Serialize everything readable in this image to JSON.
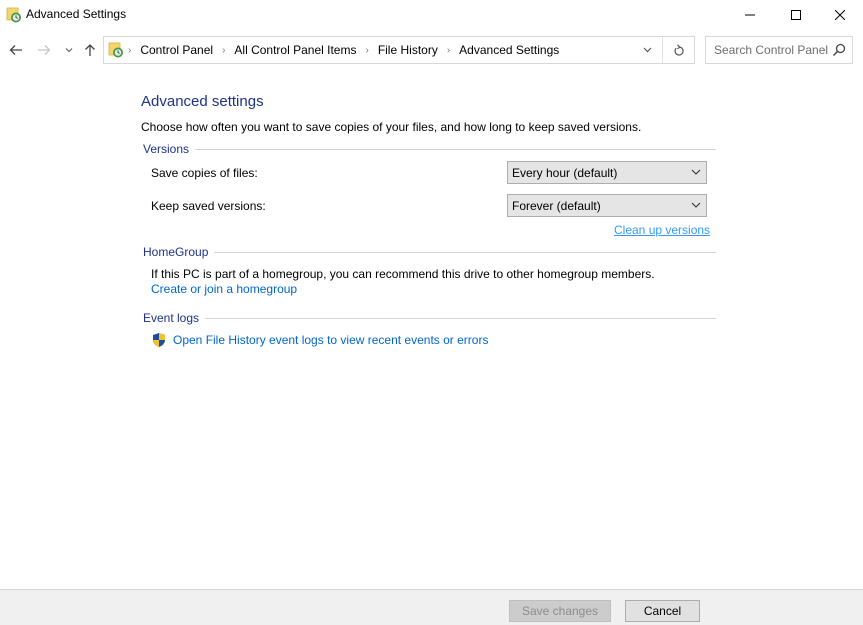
{
  "window": {
    "title": "Advanced Settings",
    "controls": {
      "minimize": "minimize",
      "maximize": "maximize",
      "close": "close"
    }
  },
  "nav": {
    "back_icon": "arrow-left-icon",
    "forward_icon": "arrow-right-icon",
    "recent_icon": "chevron-down-icon",
    "up_icon": "arrow-up-icon",
    "breadcrumbs": [
      "Control Panel",
      "All Control Panel Items",
      "File History",
      "Advanced Settings"
    ],
    "search_placeholder": "Search Control Panel"
  },
  "main": {
    "title": "Advanced settings",
    "intro": "Choose how often you want to save copies of your files, and how long to keep saved versions.",
    "versions": {
      "header": "Versions",
      "save_copies_label": "Save copies of files:",
      "save_copies_value": "Every hour (default)",
      "keep_versions_label": "Keep saved versions:",
      "keep_versions_value": "Forever (default)",
      "clean_up_link": "Clean up versions"
    },
    "homegroup": {
      "header": "HomeGroup",
      "text": "If this PC is part of a homegroup, you can recommend this drive to other homegroup members.",
      "link": "Create or join a homegroup"
    },
    "event_logs": {
      "header": "Event logs",
      "link": "Open File History event logs to view recent events or errors"
    }
  },
  "footer": {
    "save_label": "Save changes",
    "save_enabled": false,
    "cancel_label": "Cancel"
  },
  "colors": {
    "heading": "#1e3287",
    "link": "#0066cc",
    "footer_bg": "#f0f0f0"
  }
}
